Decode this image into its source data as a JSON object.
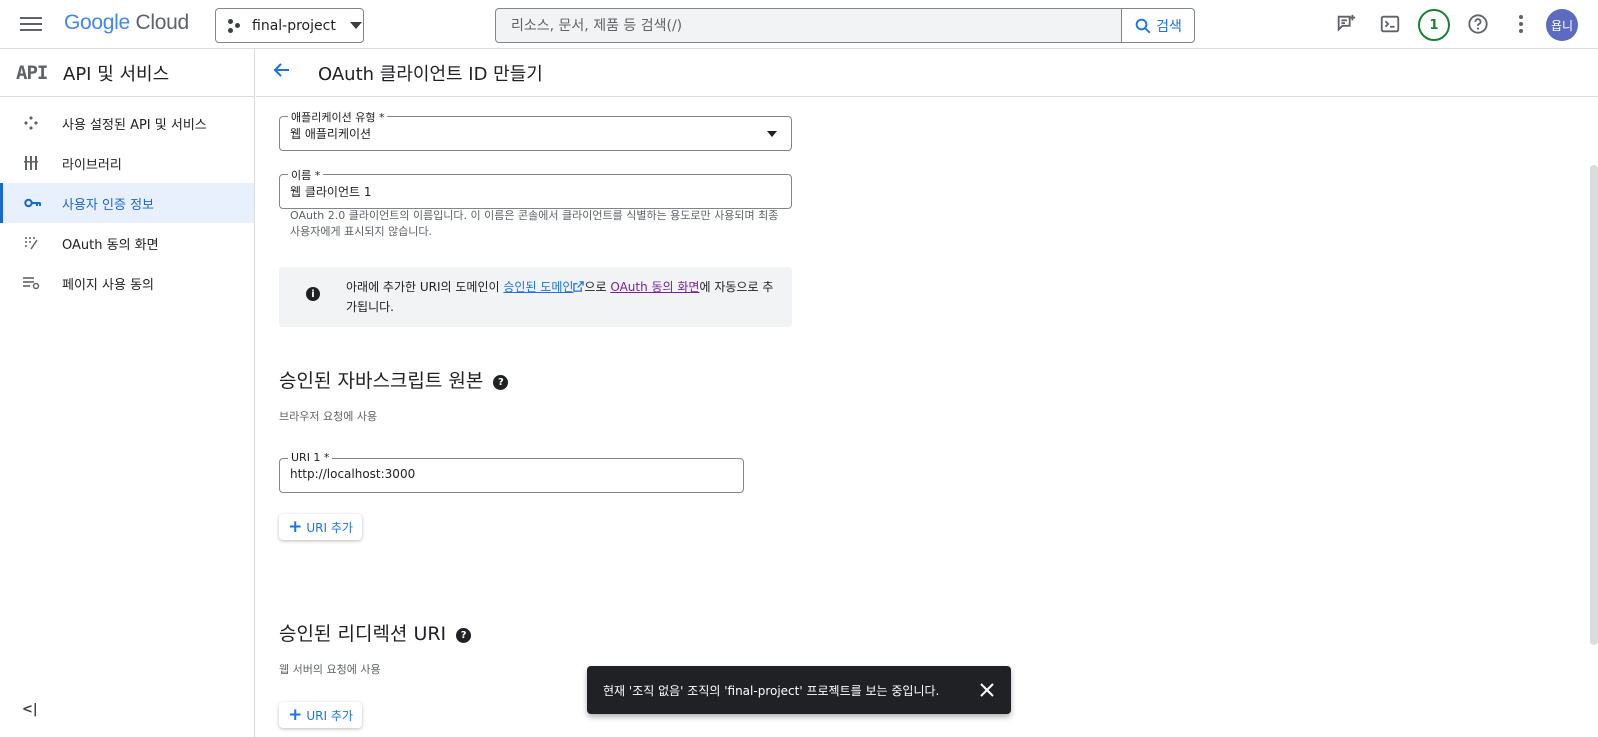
{
  "header": {
    "logo_google": "Google",
    "logo_cloud": "Cloud",
    "project_name": "final-project",
    "search_placeholder": "리소스, 문서, 제품 등 검색(/)",
    "search_button": "검색",
    "notification_count": "1",
    "avatar_text": "욥니"
  },
  "sidebar": {
    "logo": "API",
    "title": "API 및 서비스",
    "items": [
      {
        "label": "사용 설정된 API 및 서비스",
        "icon": "api-diamond-icon",
        "active": false
      },
      {
        "label": "라이브러리",
        "icon": "library-icon",
        "active": false
      },
      {
        "label": "사용자 인증 정보",
        "icon": "key-icon",
        "active": true
      },
      {
        "label": "OAuth 동의 화면",
        "icon": "consent-dots-icon",
        "active": false
      },
      {
        "label": "페이지 사용 동의",
        "icon": "page-settings-icon",
        "active": false
      }
    ],
    "collapse": "<|"
  },
  "page": {
    "title": "OAuth 클라이언트 ID 만들기"
  },
  "form": {
    "app_type_label": "애플리케이션 유형 *",
    "app_type_value": "웹 애플리케이션",
    "name_label": "이름 *",
    "name_value": "웹 클라이언트 1",
    "name_hint": "OAuth 2.0 클라이언트의 이름입니다. 이 이름은 콘솔에서 클라이언트를 식별하는 용도로만 사용되며 최종 사용자에게 표시되지 않습니다.",
    "info_pre": "아래에 추가한 URI의 도메인이 ",
    "info_link1": "승인된 도메인",
    "info_mid": "으로 ",
    "info_link2": "OAuth 동의 화면",
    "info_post": "에 자동으로 추가됩니다.",
    "js_origins_title": "승인된 자바스크립트 원본",
    "js_origins_sub": "브라우저 요청에 사용",
    "uri1_label": "URI 1 *",
    "uri1_value": "http://localhost:3000",
    "add_uri": "URI 추가",
    "redirect_title": "승인된 리디렉션 URI",
    "redirect_sub": "웹 서버의 요청에 사용",
    "add_uri2": "URI 추가"
  },
  "snackbar": {
    "message": "현재 '조직 없음' 조직의 'final-project' 프로젝트를 보는 중입니다."
  },
  "colors": {
    "accent": "#1a73e8",
    "active_bg": "#e8f0fe",
    "badge_green": "#188038",
    "avatar": "#5c6bc0"
  }
}
